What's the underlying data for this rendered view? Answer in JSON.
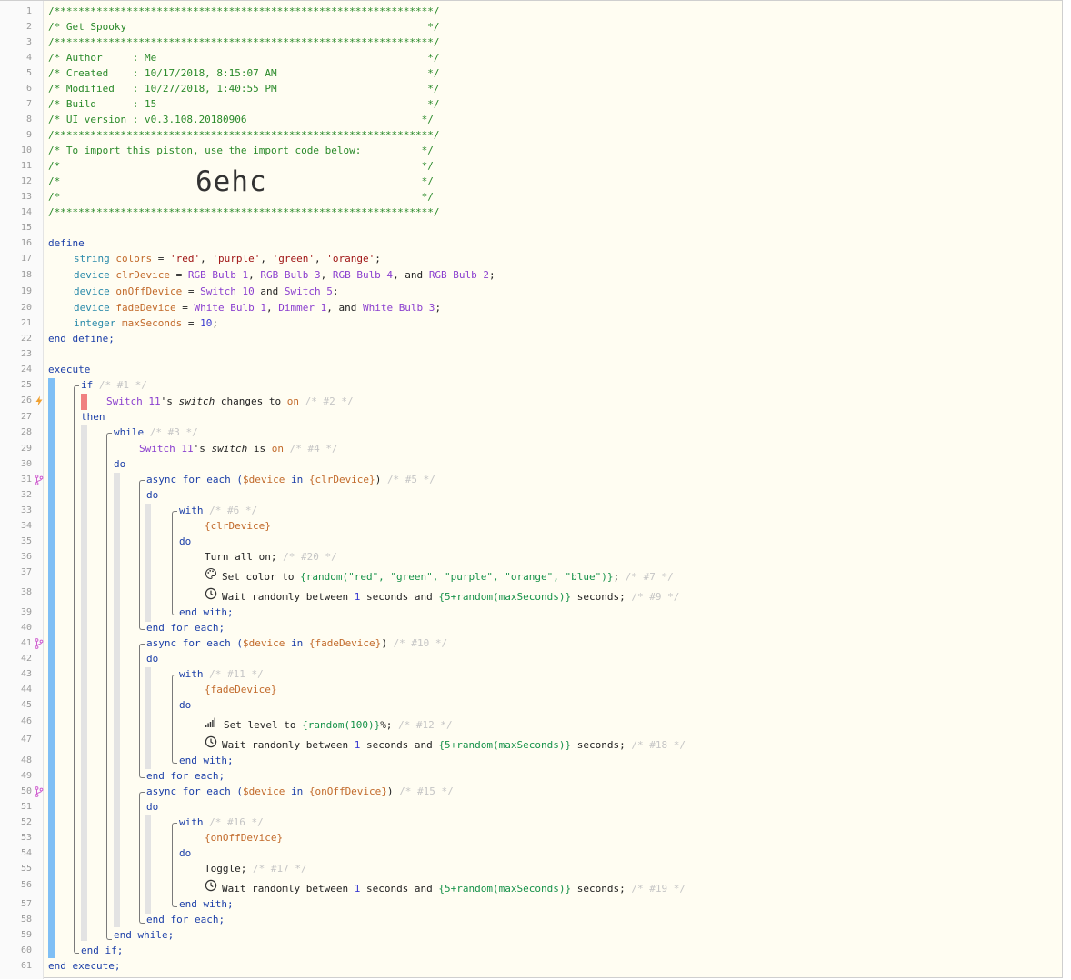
{
  "header": {
    "stars": "/***************************************************************/",
    "title": "/* Get Spooky                                                  */",
    "author": "/* Author     : Me                                             */",
    "created": "/* Created    : 10/17/2018, 8:15:07 AM                         */",
    "modified": "/* Modified   : 10/27/2018, 1:40:55 PM                         */",
    "build": "/* Build      : 15                                             */",
    "ui_version": "/* UI version : v0.3.108.20180906                             */",
    "import_note": "/* To import this piston, use the import code below:          */",
    "blank": "/*                                                            */",
    "import_code": "6ehc"
  },
  "line_numbers": [
    "1",
    "2",
    "3",
    "4",
    "5",
    "6",
    "7",
    "8",
    "9",
    "10",
    "11",
    "12",
    "13",
    "14",
    "15",
    "16",
    "17",
    "18",
    "19",
    "20",
    "21",
    "22",
    "23",
    "24",
    "25",
    "26",
    "27",
    "28",
    "29",
    "30",
    "31",
    "32",
    "33",
    "34",
    "35",
    "36",
    "37",
    "38",
    "39",
    "40",
    "41",
    "42",
    "43",
    "44",
    "45",
    "46",
    "47",
    "48",
    "49",
    "50",
    "51",
    "52",
    "53",
    "54",
    "55",
    "56",
    "57",
    "58",
    "59",
    "60",
    "61"
  ],
  "define": {
    "kw_define": "define",
    "colors": {
      "type": "string",
      "name": "colors",
      "v1": "'red'",
      "v2": "'purple'",
      "v3": "'green'",
      "v4": "'orange'"
    },
    "clrDevice": {
      "type": "device",
      "name": "clrDevice",
      "d1": "RGB Bulb 1",
      "d2": "RGB Bulb 3",
      "d3": "RGB Bulb 4",
      "d4": "RGB Bulb 2"
    },
    "onOffDevice": {
      "type": "device",
      "name": "onOffDevice",
      "d1": "Switch 10",
      "d2": "Switch 5"
    },
    "fadeDevice": {
      "type": "device",
      "name": "fadeDevice",
      "d1": "White Bulb 1",
      "d2": "Dimmer 1",
      "d3": "White Bulb 3"
    },
    "maxSeconds": {
      "type": "integer",
      "name": "maxSeconds",
      "value": "10"
    },
    "end_define": "end define;"
  },
  "execute": {
    "kw_execute": "execute",
    "if_kw": "if",
    "if_c": "/* #1 */",
    "cond_dev": "Switch 11",
    "cond_s": "'s ",
    "cond_attr": "switch",
    "cond_op": " changes to ",
    "cond_val": "on",
    "cond_c": "/* #2 */",
    "then": "then",
    "while_kw": "while",
    "while_c": "/* #3 */",
    "wcond_dev": "Switch 11",
    "wcond_s": "'s ",
    "wcond_attr": "switch",
    "wcond_op": " is ",
    "wcond_val": "on",
    "wcond_c": "/* #4 */",
    "do": "do",
    "fe1": {
      "head": "async for each (",
      "var": "$device",
      "in": " in ",
      "list": "{clrDevice}",
      "close": ")",
      "c": "/* #5 */"
    },
    "with1": {
      "kw": "with",
      "c": "/* #6 */",
      "dev": "{clrDevice}"
    },
    "turn_on": "Turn all on;",
    "turn_on_c": "/* #20 */",
    "set_color": "Set color to ",
    "set_color_expr": "{random(\"red\", \"green\", \"purple\", \"orange\", \"blue\")}",
    "set_color_end": ";",
    "set_color_c": "/* #7 */",
    "wait_txt": "Wait randomly between ",
    "wait_min": "1",
    "wait_mid": " seconds and ",
    "wait_expr": "{5+random(maxSeconds)}",
    "wait_end": " seconds;",
    "wait1_c": "/* #9 */",
    "end_with": "end with;",
    "end_for_each": "end for each;",
    "fe2": {
      "head": "async for each (",
      "var": "$device",
      "in": " in ",
      "list": "{fadeDevice}",
      "close": ")",
      "c": "/* #10 */"
    },
    "with2": {
      "kw": "with",
      "c": "/* #11 */",
      "dev": "{fadeDevice}"
    },
    "set_level": "Set level to ",
    "set_level_expr": "{random(100)}",
    "set_level_end": "%;",
    "set_level_c": "/* #12 */",
    "wait2_c": "/* #18 */",
    "fe3": {
      "head": "async for each (",
      "var": "$device",
      "in": " in ",
      "list": "{onOffDevice}",
      "close": ")",
      "c": "/* #15 */"
    },
    "with3": {
      "kw": "with",
      "c": "/* #16 */",
      "dev": "{onOffDevice}"
    },
    "toggle": "Toggle;",
    "toggle_c": "/* #17 */",
    "wait3_c": "/* #19 */",
    "end_while": "end while;",
    "end_if": "end if;",
    "end_execute": "end execute;"
  },
  "colors": {
    "bar_blue": "#7fbff5",
    "bar_gray": "#e3e3e3",
    "trigger_red": "#f08080",
    "flash_orange": "#f0a030",
    "async_pink": "#d060d0"
  }
}
